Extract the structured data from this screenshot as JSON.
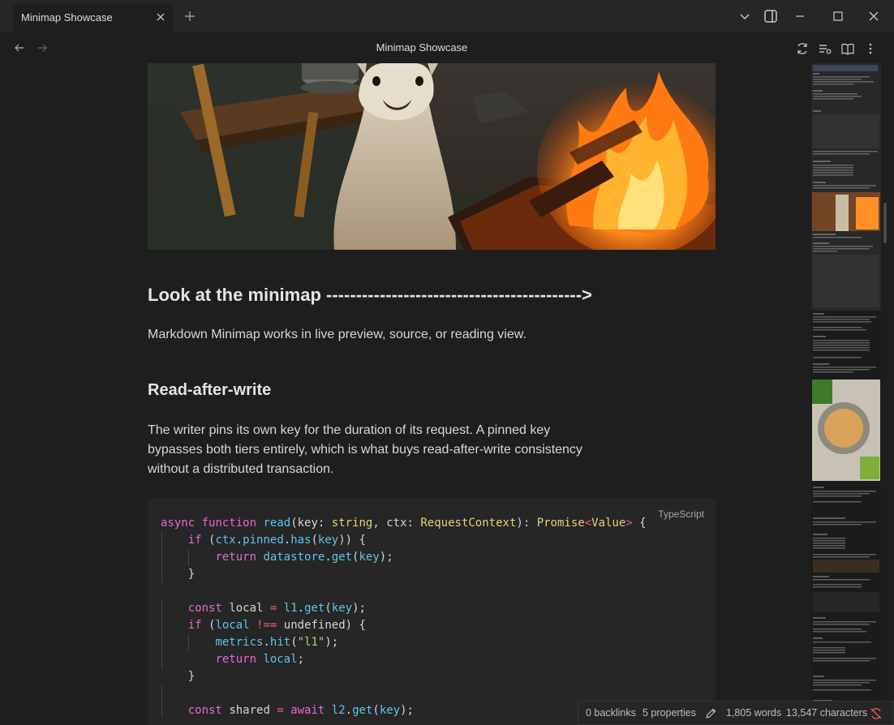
{
  "tab": {
    "title": "Minimap Showcase"
  },
  "header": {
    "title": "Minimap Showcase"
  },
  "icons": {
    "close": "close-icon",
    "new_tab": "plus-icon",
    "chevron": "chevron-down-icon",
    "sidebar": "sidebar-toggle-icon",
    "minimize": "minimize-icon",
    "maximize": "maximize-icon",
    "back": "arrow-left-icon",
    "forward": "arrow-right-icon",
    "sync": "sync-icon",
    "list": "list-settings-icon",
    "book": "reading-view-icon",
    "more": "more-vertical-icon",
    "edit": "pencil-icon",
    "sync_off": "sync-disabled-icon"
  },
  "note": {
    "heading": "Look at the minimap ------------------------------------------->",
    "intro": "Markdown Minimap works in live preview, source, or reading view.",
    "subheading": "Read-after-write",
    "paragraph": "The writer pins its own key for the duration of its request. A pinned key bypasses both tiers entirely, which is what buys read-after-write consistency without a distributed transaction.",
    "code_language": "TypeScript"
  },
  "status": {
    "backlinks": "0 backlinks",
    "properties": "5 properties",
    "words": "1,805 words",
    "characters": "13,547 characters"
  },
  "colors": {
    "background": "#1e1e1e",
    "code_bg": "#262626",
    "keyword": "#e06ccf",
    "function": "#56c8f0",
    "type": "#e3d37a",
    "string": "#9ed68a",
    "operator": "#ee5f78",
    "sync_off": "#e0565b"
  }
}
